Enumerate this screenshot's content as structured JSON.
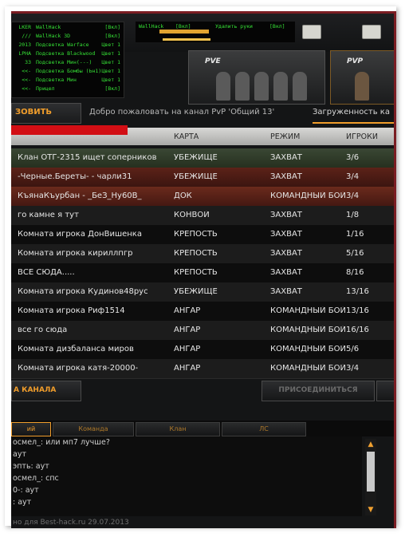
{
  "cheat_menu_left": {
    "rows": [
      {
        "key": "LKER",
        "name": "WallHack",
        "value": "[Вкл]"
      },
      {
        "key": "///",
        "name": "WallHack 3D",
        "value": "[Вкл]"
      },
      {
        "key": "2013",
        "name": "Подсветка Warface",
        "value": "Цвет 1"
      },
      {
        "key": "LPHA",
        "name": "Подсветка Blackwood",
        "value": "Цвет 1"
      },
      {
        "key": "33",
        "name": "Подсветка Мин(---)",
        "value": "Цвет 1"
      },
      {
        "key": "<<-",
        "name": "Подсветка Бомбы (Ьн1)",
        "value": "Цвет 1"
      },
      {
        "key": "<<-",
        "name": "Подсветка Мин",
        "value": "Цвет 1"
      },
      {
        "key": "<<-",
        "name": "Прицел",
        "value": "[Вкл]"
      }
    ],
    "highlight_color": "#35e035"
  },
  "cheat_menu_right": {
    "rows": [
      {
        "name": "WallHack",
        "value": "[Вкл]",
        "name2": "Удалить руки",
        "value2": "[Вкл]"
      }
    ]
  },
  "mode_tabs": {
    "pve_label": "PVE",
    "pvp_label": "PVP"
  },
  "channel": {
    "button_label": "ЗОВИТЬ",
    "welcome_text": "Добро пожаловать на канал PvP 'Общий 13'",
    "load_text": "Загруженность ка"
  },
  "table": {
    "headers": [
      "",
      "КАРТА",
      "РЕЖИМ",
      "ИГРОКИ"
    ],
    "rows": [
      {
        "name": "Клан ОТГ-2315 ищет соперников",
        "map": "УБЕЖИЩЕ",
        "mode": "ЗАХВАТ",
        "players": "3/6",
        "style": "green"
      },
      {
        "name": "-Черные.Береты- - чарли31",
        "map": "УБЕЖИЩЕ",
        "mode": "ЗАХВАТ",
        "players": "3/4",
        "style": "red"
      },
      {
        "name": "КъянаКъурбан - _БеЗ_Ну60В_",
        "map": "ДОК",
        "mode": "КОМАНДНЫЙ БОЙ",
        "players": "3/4",
        "style": "red2"
      },
      {
        "name": "го камне  я тут",
        "map": "КОНВОЙ",
        "mode": "ЗАХВАТ",
        "players": "1/8",
        "style": "alt"
      },
      {
        "name": "Комната игрока ДонВишенка",
        "map": "КРЕПОСТЬ",
        "mode": "ЗАХВАТ",
        "players": "1/16",
        "style": "norm"
      },
      {
        "name": "Комната игрока кириллпгр",
        "map": "КРЕПОСТЬ",
        "mode": "ЗАХВАТ",
        "players": "5/16",
        "style": "alt"
      },
      {
        "name": "ВСЕ СЮДА.....",
        "map": "КРЕПОСТЬ",
        "mode": "ЗАХВАТ",
        "players": "8/16",
        "style": "norm"
      },
      {
        "name": "Комната игрока Кудинов48рус",
        "map": "УБЕЖИЩЕ",
        "mode": "ЗАХВАТ",
        "players": "13/16",
        "style": "alt"
      },
      {
        "name": "Комната игрока Риф1514",
        "map": "АНГАР",
        "mode": "КОМАНДНЫЙ БОЙ",
        "players": "13/16",
        "style": "norm"
      },
      {
        "name": "все го сюда",
        "map": "АНГАР",
        "mode": "КОМАНДНЫЙ БОЙ",
        "players": "16/16",
        "style": "alt"
      },
      {
        "name": "Комната дизбаланса миров",
        "map": "АНГАР",
        "mode": "КОМАНДНЫЙ БОЙ",
        "players": "5/6",
        "style": "norm"
      },
      {
        "name": "Комната игрока катя-20000-",
        "map": "АНГАР",
        "mode": "КОМАНДНЫЙ БОЙ",
        "players": "3/4",
        "style": "alt"
      }
    ]
  },
  "bottom_buttons": {
    "channel_label": "А КАНАЛА",
    "join_label": "ПРИСОЕДИНИТЬСЯ"
  },
  "chat_tabs": [
    "ий",
    "Команда",
    "Клан",
    "ЛС"
  ],
  "chat_lines": [
    "осмел_: или мп7 лучше?",
    "аут",
    "эпть: аут",
    "осмел_: спс",
    "0-: аут",
    ": аут"
  ],
  "footer_text": "но для Best-hack.ru 29.07.2013",
  "colors": {
    "accent_orange": "#f09d2b",
    "brand_red": "#d20e14"
  }
}
